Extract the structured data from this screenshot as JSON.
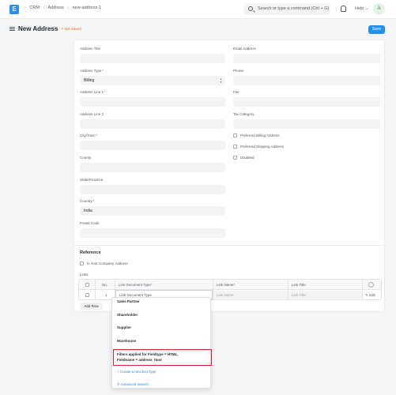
{
  "navbar": {
    "logo_letter": "E",
    "breadcrumbs": [
      "CRM",
      "Address",
      "new-address-1"
    ],
    "search_placeholder": "Search or type a command (Ctrl + G)",
    "help_label": "Help",
    "avatar_initial": "A"
  },
  "page": {
    "title": "New Address",
    "status": "Not Saved",
    "save_label": "Save"
  },
  "form": {
    "left": [
      {
        "label": "Address Title",
        "value": "",
        "required": false
      },
      {
        "label": "Address Type",
        "value": "Billing",
        "required": true
      },
      {
        "label": "Address Line 1",
        "value": "",
        "required": true
      },
      {
        "label": "Address Line 2",
        "value": "",
        "required": false
      },
      {
        "label": "City/Town",
        "value": "",
        "required": true
      },
      {
        "label": "County",
        "value": "",
        "required": false
      },
      {
        "label": "State/Province",
        "value": "",
        "required": false
      },
      {
        "label": "Country",
        "value": "India",
        "required": true
      },
      {
        "label": "Postal Code",
        "value": "",
        "required": false
      }
    ],
    "right": [
      {
        "label": "Email Address",
        "value": ""
      },
      {
        "label": "Phone",
        "value": ""
      },
      {
        "label": "Fax",
        "value": ""
      },
      {
        "label": "Tax Category",
        "value": ""
      }
    ],
    "checkboxes": [
      "Preferred Billing Address",
      "Preferred Shipping Address",
      "Disabled"
    ],
    "required_mark": "*"
  },
  "reference": {
    "title": "Reference",
    "company_checkbox": "Is Your Company Address",
    "links_label": "Links",
    "columns": {
      "no": "No.",
      "doctype": "Link Document Type",
      "name": "Link Name",
      "title": "Link Title"
    },
    "row": {
      "no": "1",
      "doctype_placeholder": "Link Document Type",
      "name_placeholder": "Link Name",
      "title_placeholder": "Link Title",
      "edit_label": "Edit"
    },
    "add_row_label": "Add Row"
  },
  "dropdown": {
    "items": [
      "Sales Partner",
      "Shareholder",
      "Supplier",
      "Warehouse"
    ],
    "filter_line1": "Filters applied for Fieldtype = HTML,",
    "filter_line2": "Fieldname = address_html",
    "create_label": "+ Create a new DocType",
    "advanced_label": "Advanced Search"
  },
  "colors": {
    "accent": "#2490ef",
    "warning": "#e86c13",
    "highlight": "#e02020"
  }
}
